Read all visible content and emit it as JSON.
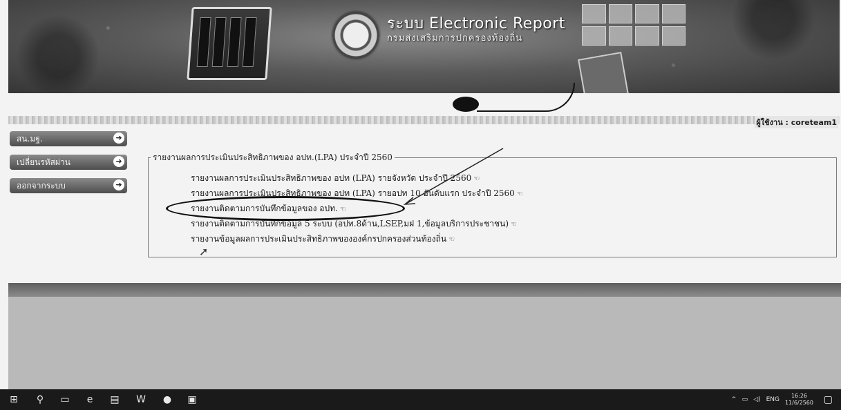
{
  "banner": {
    "title": "ระบบ Electronic Report",
    "subtitle": "กรมส่งเสริมการปกครองท้องถิ่น"
  },
  "user": {
    "label": "ผู้ใช้งาน : coreteam1"
  },
  "nav": {
    "items": [
      {
        "label": "สน.มฐ."
      },
      {
        "label": "เปลี่ยนรหัสผ่าน"
      },
      {
        "label": "ออกจากระบบ"
      }
    ]
  },
  "report": {
    "legend": "รายงานผลการประเมินประสิทธิภาพของ อปท.(LPA) ประจำปี 2560",
    "links": [
      {
        "label": "รายงานผลการประเมินประสิทธิภาพของ อปท (LPA) รายจังหวัด ประจำปี 2560"
      },
      {
        "label": "รายงานผลการประเมินประสิทธิภาพของ อปท (LPA) รายอปท 10 อันดับแรก ประจำปี 2560"
      },
      {
        "label": "รายงานติดตามการบันทึกข้อมูลของ อปท."
      },
      {
        "label": "รายงานติดตามการบันทึกข้อมูล 5 ระบบ (อปท.8ด้าน,LSEP,มฝ 1,ข้อมูลบริการประชาชน)"
      },
      {
        "label": "รายงานข้อมูลผลการประเมินประสิทธิภาพขององค์กรปกครองส่วนท้องถิ่น"
      }
    ],
    "pointer_glyph": "☜"
  },
  "taskbar": {
    "language": "ENG",
    "time": "16:26",
    "date": "11/6/2560"
  }
}
